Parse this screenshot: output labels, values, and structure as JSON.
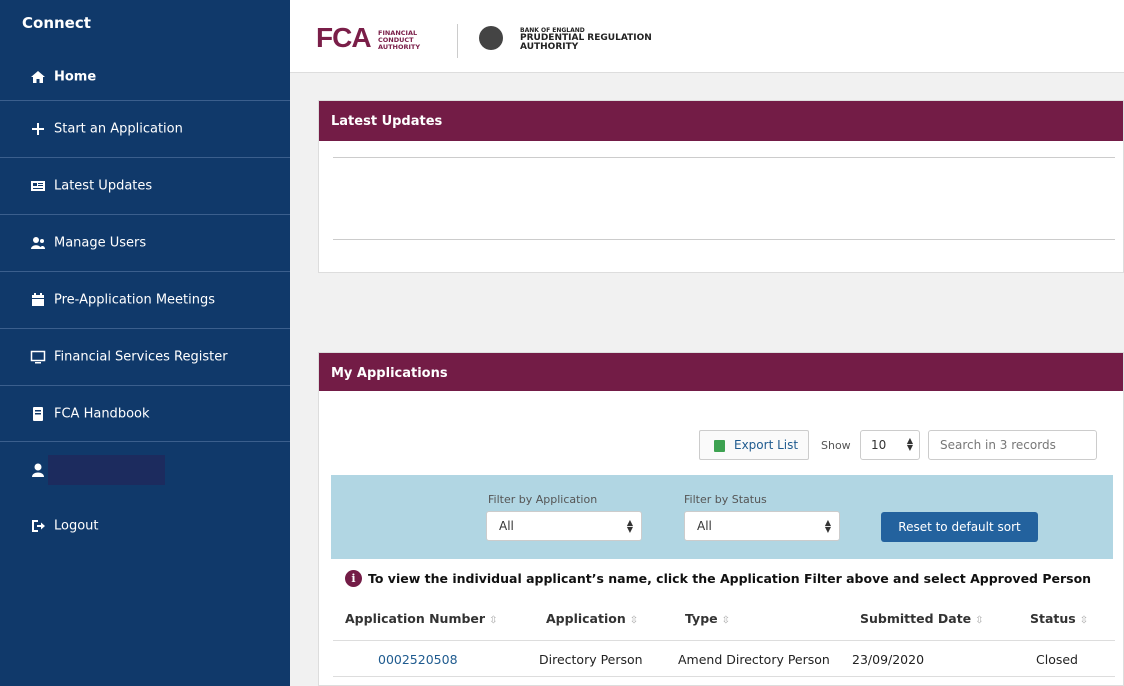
{
  "sidebar": {
    "brand": "Connect",
    "home": "Home",
    "items": [
      {
        "label": "Start an Application",
        "icon": "plus-icon"
      },
      {
        "label": "Latest Updates",
        "icon": "newspaper-icon"
      },
      {
        "label": "Manage Users",
        "icon": "users-icon"
      },
      {
        "label": "Pre-Application Meetings",
        "icon": "calendar-icon"
      },
      {
        "label": "Financial Services Register",
        "icon": "monitor-icon"
      },
      {
        "label": "FCA Handbook",
        "icon": "book-icon"
      }
    ],
    "logout": "Logout"
  },
  "header": {
    "fca_letters": "FCA",
    "fca_line1": "FINANCIAL",
    "fca_line2": "CONDUCT",
    "fca_line3": "AUTHORITY",
    "boe_line1": "BANK OF ENGLAND",
    "boe_line2": "PRUDENTIAL REGULATION",
    "boe_line3": "AUTHORITY"
  },
  "latest_updates": {
    "title": "Latest Updates"
  },
  "my_applications": {
    "title": "My Applications",
    "export_label": "Export List",
    "show_label": "Show",
    "show_value": "10",
    "search_placeholder": "Search in 3 records",
    "filter_application_label": "Filter by Application",
    "filter_application_value": "All",
    "filter_status_label": "Filter by Status",
    "filter_status_value": "All",
    "reset_label": "Reset to default sort",
    "info_text": "To view the individual applicant’s name, click the Application Filter above and select Approved Person",
    "columns": [
      "Application Number",
      "Application",
      "Type",
      "Submitted Date",
      "Status"
    ],
    "rows": [
      [
        "0002520508",
        "Directory Person",
        "Amend Directory Person",
        "23/09/2020",
        "Closed"
      ]
    ]
  },
  "colors": {
    "sidebar": "#10396a",
    "panel_header": "#731c46",
    "filter_bar": "#b1d6e3",
    "accent": "#23629e"
  }
}
